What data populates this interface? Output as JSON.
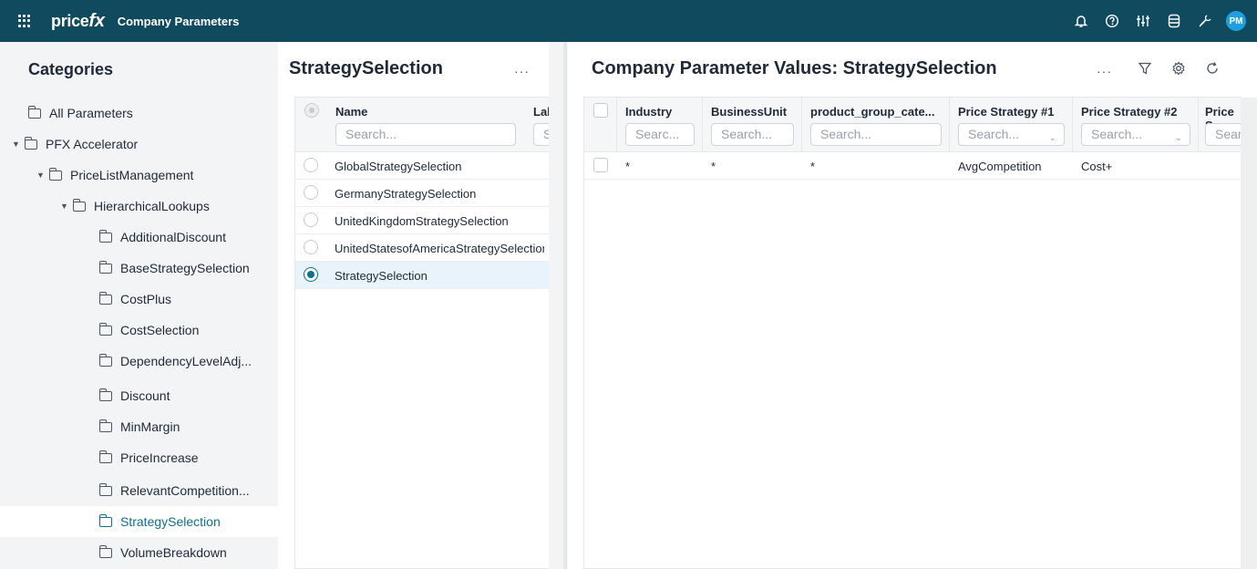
{
  "app": {
    "logo_text": "price",
    "logo_accent": "fx",
    "title": "Company Parameters",
    "avatar_initials": "PM",
    "top_icons": [
      "bell-icon",
      "help-icon",
      "sliders-icon",
      "database-icon",
      "tools-icon"
    ]
  },
  "categories": {
    "title": "Categories",
    "items": [
      {
        "label": "All Parameters"
      },
      {
        "label": "PFX Accelerator"
      },
      {
        "label": "PriceListManagement"
      },
      {
        "label": "HierarchicalLookups"
      },
      {
        "label": "AdditionalDiscount"
      },
      {
        "label": "BaseStrategySelection"
      },
      {
        "label": "CostPlus"
      },
      {
        "label": "CostSelection"
      },
      {
        "label": "DependencyLevelAdj..."
      },
      {
        "label": "Discount"
      },
      {
        "label": "MinMargin"
      },
      {
        "label": "PriceIncrease"
      },
      {
        "label": "RelevantCompetition..."
      },
      {
        "label": "StrategySelection"
      },
      {
        "label": "VolumeBreakdown"
      }
    ]
  },
  "middle": {
    "title": "StrategySelection",
    "more_label": "···",
    "columns": [
      {
        "label": "Name",
        "placeholder": "Search..."
      },
      {
        "label": "Lal",
        "placeholder": "S"
      }
    ],
    "rows": [
      "GlobalStrategySelection",
      "GermanyStrategySelection",
      "UnitedKingdomStrategySelection",
      "UnitedStatesofAmericaStrategySelection",
      "StrategySelection"
    ]
  },
  "right": {
    "title": "Company Parameter Values: StrategySelection",
    "more_label": "···",
    "columns": [
      {
        "label": "Industry",
        "placeholder": "Searc..."
      },
      {
        "label": "BusinessUnit",
        "placeholder": "Search..."
      },
      {
        "label": "product_group_cate...",
        "placeholder": "Search..."
      },
      {
        "label": "Price Strategy #1",
        "placeholder": "Search..."
      },
      {
        "label": "Price Strategy #2",
        "placeholder": "Search..."
      },
      {
        "label": "Price S",
        "placeholder": "Sear"
      }
    ],
    "rows": [
      [
        "*",
        "*",
        "*",
        "AvgCompetition",
        "Cost+",
        ""
      ]
    ]
  },
  "colors": {
    "topbar": "#0f4a5e",
    "accent": "#0f6f8f",
    "avatar": "#1ea0e0"
  }
}
